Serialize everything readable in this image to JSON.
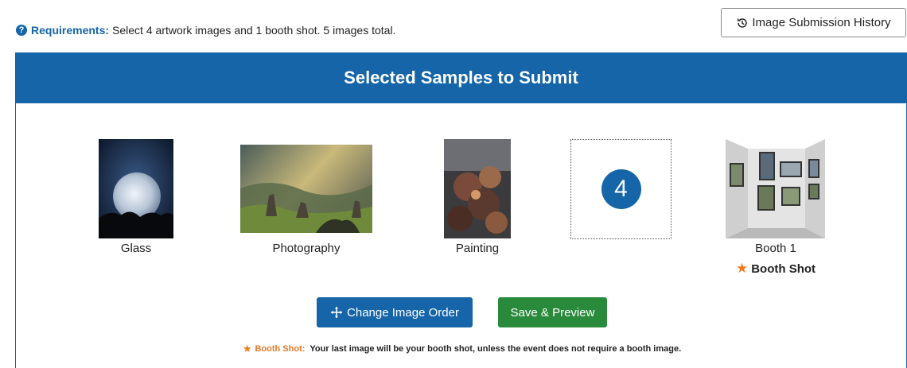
{
  "requirements": {
    "label": "Requirements:",
    "text": "Select 4 artwork images and 1 booth shot. 5 images total."
  },
  "history_button": {
    "label": "Image Submission History"
  },
  "panel": {
    "title": "Selected Samples to Submit"
  },
  "samples": [
    {
      "caption": "Glass"
    },
    {
      "caption": "Photography"
    },
    {
      "caption": "Painting"
    },
    {
      "slot_number": "4"
    },
    {
      "caption": "Booth 1",
      "badge": "Booth Shot"
    }
  ],
  "buttons": {
    "change_order": "Change Image Order",
    "save_preview": "Save & Preview"
  },
  "note": {
    "label": "Booth Shot:",
    "text": "Your last image will be your booth shot, unless the event does not require a booth image."
  },
  "colors": {
    "primary": "#1565a8",
    "success": "#2a8a3c",
    "accent": "#f07a1a"
  }
}
